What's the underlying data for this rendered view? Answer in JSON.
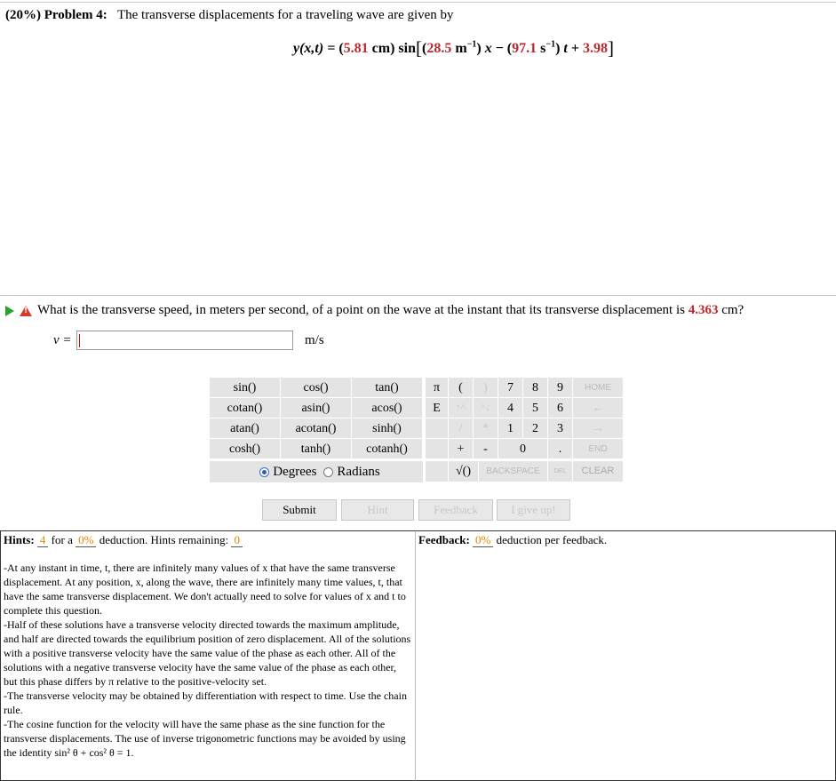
{
  "problem": {
    "label": "(20%) Problem 4:",
    "text": "The transverse displacements for a traveling wave are given by"
  },
  "equation": {
    "lhs": "y(x,t) = ",
    "amp": "5.81",
    "amp_unit": "cm",
    "sin": "sin",
    "k": "28.5",
    "k_unit": "m",
    "omega": "97.1",
    "omega_unit": "s",
    "exp": "−1",
    "x": "x",
    "t": "t",
    "phi": "3.98"
  },
  "question": {
    "text": "What is the transverse speed, in meters per second, of a point on the wave at the instant that its transverse displacement is",
    "value": "4.363",
    "unit": "cm?"
  },
  "answer": {
    "label": "v =",
    "value": "",
    "unit": "m/s"
  },
  "calculator": {
    "functions": [
      [
        "sin()",
        "cos()",
        "tan()"
      ],
      [
        "cotan()",
        "asin()",
        "acos()"
      ],
      [
        "atan()",
        "acotan()",
        "sinh()"
      ],
      [
        "cosh()",
        "tanh()",
        "cotanh()"
      ]
    ],
    "col1": [
      "π",
      "E",
      "",
      ""
    ],
    "col2": [
      "(",
      "↑^",
      "/",
      "+"
    ],
    "col3": [
      ")",
      "^↓",
      "*",
      "-"
    ],
    "digits": [
      [
        "7",
        "8",
        "9"
      ],
      [
        "4",
        "5",
        "6"
      ],
      [
        "1",
        "2",
        "3"
      ]
    ],
    "zero": "0",
    "dot": ".",
    "side": [
      "HOME",
      "←",
      "→",
      "END"
    ],
    "sqrt": "√()",
    "backspace": "BACKSPACE",
    "del": "DEL",
    "clear": "CLEAR",
    "degrees": "Degrees",
    "radians": "Radians"
  },
  "buttons": {
    "submit": "Submit",
    "hint": "Hint",
    "feedback": "Feedback",
    "give_up": "I give up!"
  },
  "hints": {
    "label": "Hints:",
    "count": "4",
    "for_a": "for a",
    "deduction": "0%",
    "deduction_text": "deduction. Hints remaining:",
    "remaining": "0",
    "items": [
      "-At any instant in time, t, there are infinitely many values of x that have the same transverse displacement. At any position, x, along the wave, there are infinitely many time values, t, that have the same transverse displacement. We don't actually need to solve for values of x and t to complete this question.",
      "-Half of these solutions have a transverse velocity directed towards the maximum amplitude, and half are directed towards the equilibrium position of zero displacement. All of the solutions with a positive transverse velocity have the same value of the phase as each other. All of the solutions with a negative transverse velocity have the same value of the phase as each other, but this phase differs by π relative to the positive-velocity set.",
      "-The transverse velocity may be obtained by differentiation with respect to time. Use the chain rule.",
      "-The cosine function for the velocity will have the same phase as the sine function for the transverse displacements. The use of inverse trigonometric functions may be avoided by using the identity sin² θ + cos² θ = 1."
    ]
  },
  "feedback": {
    "label": "Feedback:",
    "deduction": "0%",
    "text": "deduction per feedback."
  },
  "colors": {
    "accent_red": "#c0272d",
    "orange": "#e08a00",
    "key_gray": "#e4e4e4"
  },
  "icons": {
    "play": "play-triangle-icon",
    "warning": "warning-triangle-icon"
  }
}
